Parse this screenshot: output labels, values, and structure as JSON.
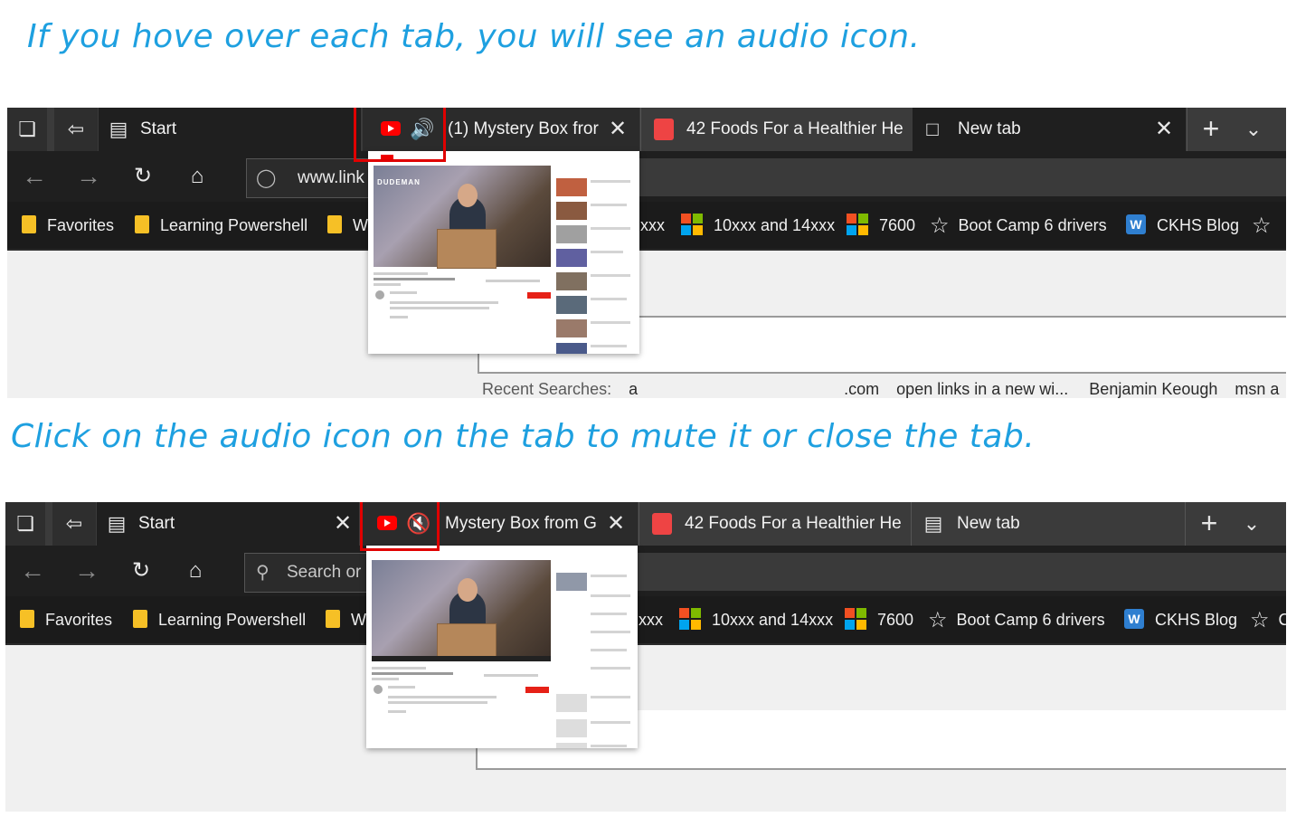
{
  "captions": {
    "hover": "If you hove over each tab, you will see an audio icon.",
    "click": "Click on the audio icon on the tab to mute it or close the tab."
  },
  "shot1": {
    "tabs": {
      "start": "Start",
      "mystery": "(1) Mystery Box fror",
      "foods": "42 Foods For a Healthier He",
      "newtab": "New tab"
    },
    "address": "www.link",
    "favorites": {
      "favorites": "Favorites",
      "learning": "Learning Powershell",
      "w": "W",
      "xxx": "xxx",
      "tenxxx": "10xxx and 14xxx",
      "n7600": "7600",
      "bootcamp": "Boot Camp 6 drivers",
      "ckhs": "CKHS Blog"
    },
    "recent": {
      "label": "Recent Searches:",
      "item0a": "a",
      "item0b": ".com",
      "item1": "open links in a new wi...",
      "item2": "Benjamin Keough",
      "item3": "msn a"
    },
    "preview": {
      "channel": "DUDEMAN"
    }
  },
  "shot2": {
    "tabs": {
      "start": "Start",
      "mystery": "Mystery Box from G",
      "foods": "42 Foods For a Healthier He",
      "newtab": "New tab"
    },
    "address": "Search or e",
    "favorites": {
      "favorites": "Favorites",
      "learning": "Learning Powershell",
      "w": "W",
      "xxx": "xxx",
      "tenxxx": "10xxx and 14xxx",
      "n7600": "7600",
      "bootcamp": "Boot Camp 6 drivers",
      "ckhs": "CKHS Blog",
      "c": "C"
    }
  },
  "icons": {
    "window": "window-icon",
    "setaside": "set-aside-icon",
    "startpage": "start-page-icon",
    "youtube": "youtube-icon",
    "speaker": "speaker-icon",
    "muted": "speaker-muted-icon",
    "close": "close-icon",
    "newtab": "plus-icon",
    "chevron": "chevron-down-icon",
    "back": "back-arrow-icon",
    "forward": "forward-arrow-icon",
    "refresh": "refresh-icon",
    "home": "home-icon",
    "globe": "globe-icon",
    "search": "search-icon",
    "folder": "folder-icon",
    "windows": "windows-logo-icon",
    "star": "star-icon",
    "wordpress": "wordpress-icon"
  },
  "colors": {
    "caption": "#1ea0e0",
    "highlight": "#e00000",
    "youtube": "#ff0000",
    "audio": "#3aa0ff"
  }
}
